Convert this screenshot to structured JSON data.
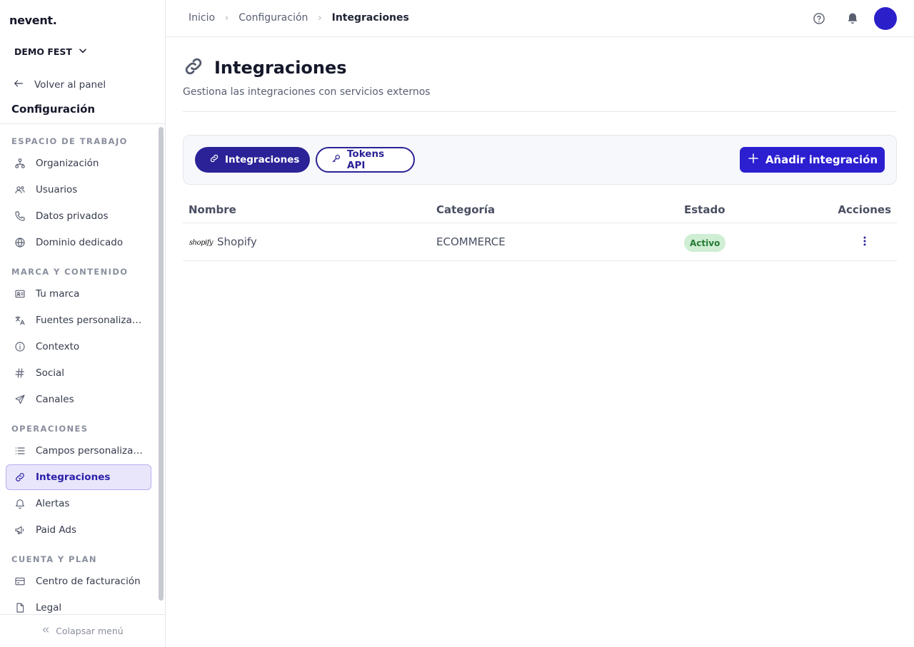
{
  "app": {
    "logo": "nevent."
  },
  "sidebar": {
    "org_name": "DEMO FEST",
    "back_label": "Volver al panel",
    "section_title": "Configuración",
    "groups": [
      {
        "label": "ESPACIO DE TRABAJO"
      },
      {
        "label": "MARCA Y CONTENIDO"
      },
      {
        "label": "OPERACIONES"
      },
      {
        "label": "CUENTA Y PLAN"
      }
    ],
    "items": [
      {
        "label": "Organización",
        "icon": "sitemap-icon"
      },
      {
        "label": "Usuarios",
        "icon": "users-icon"
      },
      {
        "label": "Datos privados",
        "icon": "phone-icon"
      },
      {
        "label": "Dominio dedicado",
        "icon": "globe-icon"
      },
      {
        "label": "Tu marca",
        "icon": "id-card-icon"
      },
      {
        "label": "Fuentes personalizadas",
        "icon": "translate-icon"
      },
      {
        "label": "Contexto",
        "icon": "info-icon"
      },
      {
        "label": "Social",
        "icon": "hashtag-icon"
      },
      {
        "label": "Canales",
        "icon": "send-icon"
      },
      {
        "label": "Campos personalizados",
        "icon": "list-icon"
      },
      {
        "label": "Integraciones",
        "icon": "link-icon",
        "active": true
      },
      {
        "label": "Alertas",
        "icon": "bell-icon"
      },
      {
        "label": "Paid Ads",
        "icon": "megaphone-icon"
      },
      {
        "label": "Centro de facturación",
        "icon": "credit-card-icon"
      },
      {
        "label": "Legal",
        "icon": "file-icon"
      }
    ],
    "collapse_label": "Colapsar menú"
  },
  "topbar": {
    "breadcrumbs": [
      "Inicio",
      "Configuración",
      "Integraciones"
    ]
  },
  "page": {
    "title": "Integraciones",
    "subtitle": "Gestiona las integraciones con servicios externos",
    "tabs": [
      "Integraciones",
      "Tokens API"
    ],
    "add_button": "Añadir integración"
  },
  "table": {
    "headers": [
      "Nombre",
      "Categoría",
      "Estado",
      "Acciones"
    ],
    "rows": [
      {
        "logo_text": "shopify",
        "name": "Shopify",
        "category": "ECOMMERCE",
        "status": "Activo"
      }
    ]
  },
  "colors": {
    "brand": "#2a2296",
    "accent_button": "#2b1fd0",
    "active_nav_bg": "#e9e6fb",
    "status_active_bg": "#cfeed3",
    "status_active_text": "#257a33"
  }
}
